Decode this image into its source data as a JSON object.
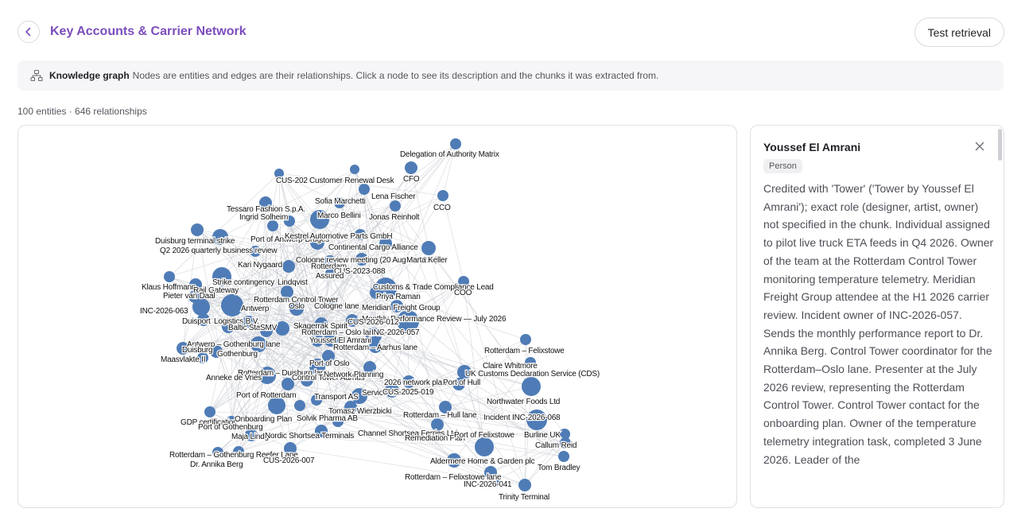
{
  "header": {
    "title": "Key Accounts & Carrier Network",
    "test_button_label": "Test retrieval"
  },
  "info": {
    "title": "Knowledge graph",
    "description": "Nodes are entities and edges are their relationships. Click a node to see its description and the chunks it was extracted from."
  },
  "stats": "100 entities · 646 relationships",
  "detail": {
    "name": "Youssef El Amrani",
    "type": "Person",
    "description": "Credited with 'Tower' ('Tower by Youssef El Amrani'); exact role (designer, artist, owner) not specified in the chunk. Individual assigned to pilot live truck ETA feeds in Q4 2026. Owner of the team at the Rotterdam Control Tower monitoring temperature telemetry. Meridian Freight Group attendee at the H1 2026 carrier review. Incident owner of INC-2026-057. Sends the monthly performance report to Dr. Annika Berg. Control Tower coordinator for the Rotterdam–Oslo lane. Presenter at the July 2026 review, representing the Rotterdam Control Tower. Control Tower contact for the onboarding plan. Owner of the temperature telemetry integration task, completed 3 June 2026. Leader of the"
  },
  "graph": {
    "labels": [
      "Delegation of Authority Matrix",
      "CUS-202",
      "Customer Renewal Desk",
      "CFO",
      "Lena Fischer",
      "Sofia Marchetti",
      "CCO",
      "Tessaro Fashion S.p.A.",
      "Marco Bellini",
      "Ingrid Solheim",
      "Jonas Reinholt",
      "Port of Antwerp-Bruges",
      "Kestrel Automotive Parts GmbH",
      "Duisburg terminal strike",
      "Q2 2026 quarterly business review",
      "Continental Cargo Alliance",
      "Cologne review meeting (20 August 2026)",
      "Marta Keller",
      "Kari Nygaard",
      "Rotterdam",
      "CUS-2023-088",
      "Assured",
      "Strike contingency",
      "Lindqvist",
      "Customs & Trade Compliance Lead",
      "Klaus Hoffmann",
      "Rail Gateway",
      "COO",
      "Pieter van Daal",
      "Rotterdam Control Tower",
      "Cologne lane",
      "Priya Raman",
      "Oslo",
      "Antwerp",
      "Meridian Freight Group",
      "INC-2026-063",
      "Monthly Performance Review — July 2026",
      "Duisport",
      "Logistics B.V.",
      "Skagerrak Spirit",
      "Baltic Star",
      "SMV",
      "CUS-2026-012",
      "Oslo lane",
      "Rotterdam – Oslo lane",
      "INC-2026-057",
      "Youssef El Amrani",
      "Antwerp – Gothenburg lane",
      "Rotterdam – Aarhus lane",
      "Duisburg",
      "Gothenburg",
      "Maasvlakte II",
      "Port of Oslo",
      "Rotterdam – Felixstowe",
      "Rotterdam – Duisburg lane",
      "Control Tower Aarhus",
      "Network Planning",
      "Claire Whitmore",
      "Anneke de Vries",
      "UK Customs Declaration Service (CDS)",
      "2026 network plan",
      "Port of Hull",
      "Port of Rotterdam",
      "Transport AS",
      "Service credit",
      "CUS-2025-019",
      "Northwater Foods Ltd",
      "Tomasz Wierzbicki",
      "Rotterdam – Hull lane",
      "Incident INC-2026-068",
      "GDP certification",
      "Onboarding Plan",
      "Solvik Pharma AB",
      "Port of Gothenburg",
      "Channel Shortsea Ferries Ltd",
      "Remediation Plan",
      "Port of Felixstowe",
      "Burline UK",
      "Maja Lindgren",
      "Nordic Shortsea Terminals",
      "Callum Reid",
      "Rotterdam – Gothenburg Reefer Lane",
      "CUS-2026-007",
      "Aldermere Home & Garden plc",
      "Tom Bradley",
      "Dr. Annika Berg",
      "Rotterdam – Felixstowe lane",
      "INC-2026-041",
      "Trinity Terminal"
    ]
  }
}
